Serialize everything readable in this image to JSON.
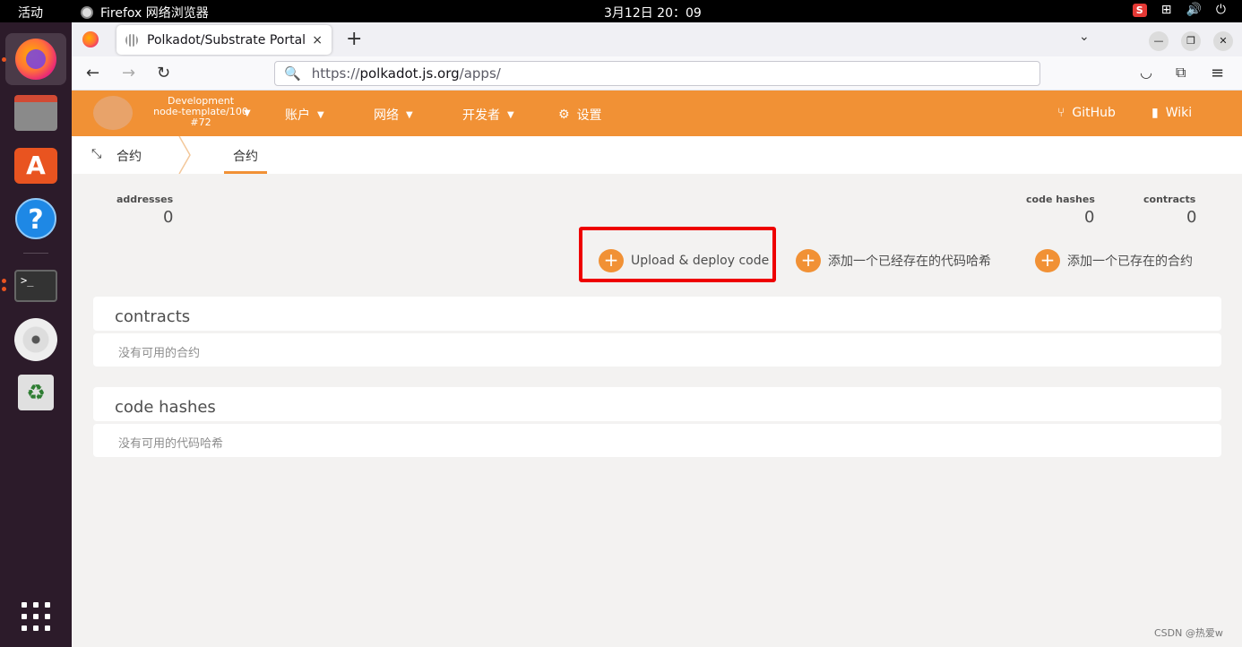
{
  "os": {
    "activities": "活动",
    "app_name": "Firefox 网络浏览器",
    "clock": "3月12日  20：09",
    "tray_badge": "S",
    "accent": "#e95420"
  },
  "browser": {
    "tab_title": "Polkadot/Substrate Portal",
    "tab_close": "×",
    "new_tab": "+",
    "url_prefix": "https://",
    "url_host": "polkadot.js.org",
    "url_path": "/apps/"
  },
  "app": {
    "header_color": "#f19135",
    "chain": {
      "name": "Development",
      "node": "node-template/100",
      "block": "#72"
    },
    "menu": {
      "accounts": "账户",
      "network": "网络",
      "developer": "开发者",
      "settings": "设置",
      "github": "GitHub",
      "wiki": "Wiki"
    },
    "breadcrumb": {
      "root": "合约",
      "tab": "合约"
    },
    "summary": {
      "addresses_label": "addresses",
      "addresses_value": "0",
      "code_hashes_label": "code hashes",
      "code_hashes_value": "0",
      "contracts_label": "contracts",
      "contracts_value": "0"
    },
    "actions": {
      "upload": "Upload & deploy code",
      "add_code_hash": "添加一个已经存在的代码哈希",
      "add_contract": "添加一个已存在的合约"
    },
    "contracts_table": {
      "header": "contracts",
      "empty": "没有可用的合约"
    },
    "code_hashes_table": {
      "header": "code hashes",
      "empty": "没有可用的代码哈希"
    }
  },
  "watermark": "CSDN @热爱w"
}
